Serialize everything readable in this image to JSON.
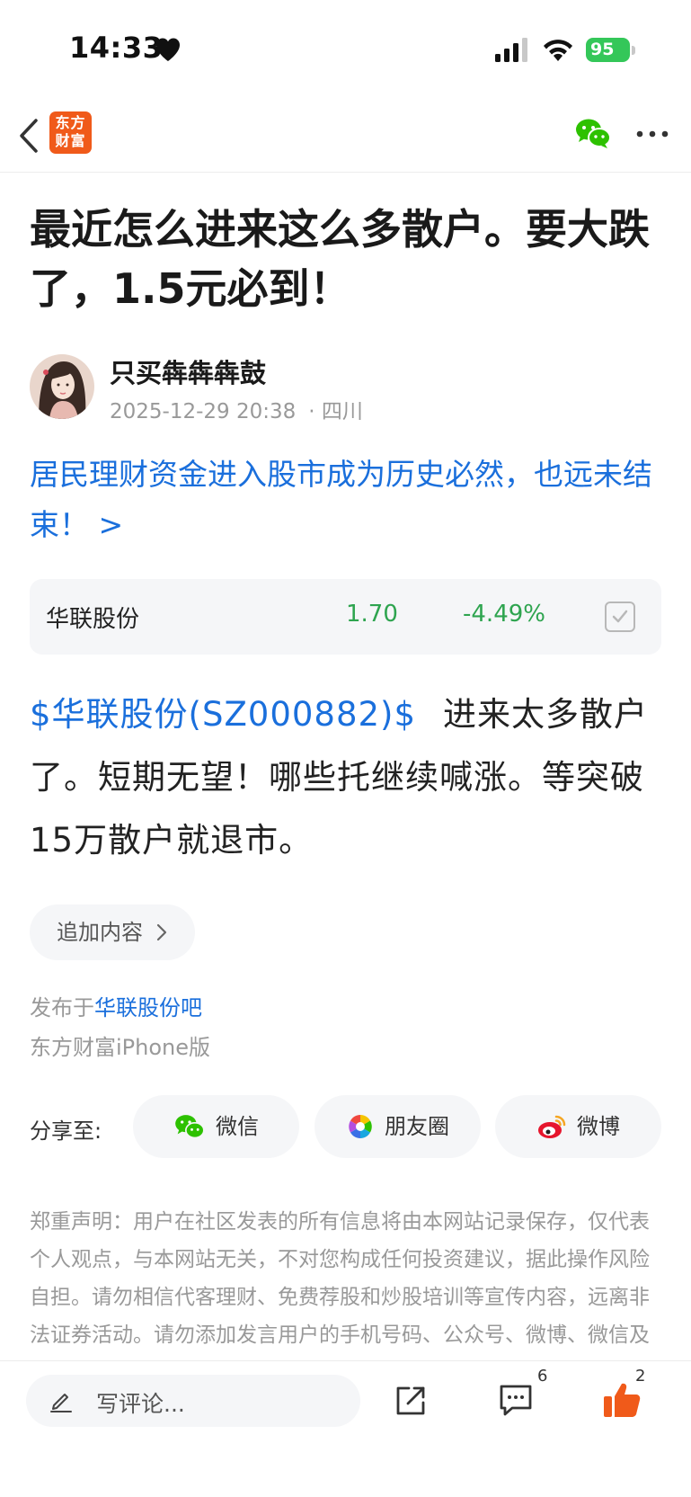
{
  "status_bar": {
    "time": "14:33",
    "battery": "95",
    "battery_color": "#34c759"
  },
  "nav": {
    "logo_text_line1": "东方",
    "logo_text_line2": "财富",
    "brand_color": "#f05a1a",
    "icons": [
      "back-icon",
      "wechat-icon",
      "more-icon"
    ]
  },
  "post": {
    "title": "最近怎么进来这么多散户。要大跌了，1.5元必到！",
    "author": "只买犇犇犇鼓",
    "date": "2025-12-29 20:38",
    "location": "· 四川",
    "topic_link": "居民理财资金进入股市成为历史必然，也远未结束！ >",
    "stock_card": {
      "name": "华联股份",
      "price": "1.70",
      "change": "-4.49%",
      "change_color": "#2ea44f"
    },
    "body_stock_link": "$华联股份(SZ000882)$",
    "body_text": "进来太多散户了。短期无望！哪些托继续喊涨。等突破15万散户就退市。",
    "append_label": "追加内容",
    "published_prefix": "发布于",
    "published_bar": "华联股份吧",
    "device": "东方财富iPhone版"
  },
  "share": {
    "label": "分享至:",
    "wechat": "微信",
    "moments": "朋友圈",
    "weibo": "微博"
  },
  "disclaimer": "郑重声明：用户在社区发表的所有信息将由本网站记录保存，仅代表个人观点，与本网站无关，不对您构成任何投资建议，据此操作风险自担。请勿相信代客理财、免费荐股和炒股培训等宣传内容，远离非法证券活动。请勿添加发言用户的手机号码、公众号、微博、微信及QQ等信息，谨防上当受骗！",
  "bottom_bar": {
    "comment_placeholder": "写评论...",
    "comment_count": "6",
    "like_count": "2",
    "like_color": "#f05a1a"
  }
}
